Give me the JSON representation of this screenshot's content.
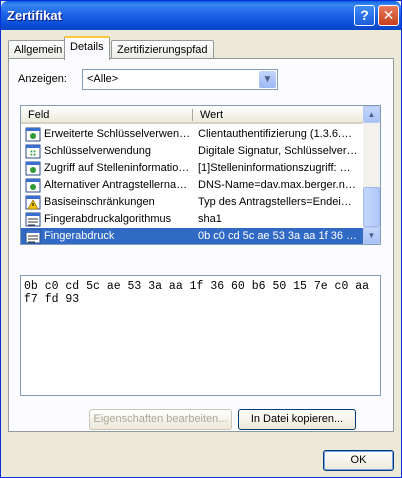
{
  "window": {
    "title": "Zertifikat",
    "help_label": "?",
    "close_label": "✕"
  },
  "tabs": [
    {
      "label": "Allgemein"
    },
    {
      "label": "Details"
    },
    {
      "label": "Zertifizierungspfad"
    }
  ],
  "show": {
    "label": "Anzeigen:",
    "value": "<Alle>"
  },
  "list": {
    "col_field": "Feld",
    "col_value": "Wert",
    "rows": [
      {
        "field": "Erweiterte Schlüsselverwen…",
        "value": "Clientauthentifizierung (1.3.6.…",
        "icon": "extension-icon"
      },
      {
        "field": "Schlüsselverwendung",
        "value": "Digitale Signatur, Schlüsselver…",
        "icon": "critical-extension-icon"
      },
      {
        "field": "Zugriff auf Stelleninformatio…",
        "value": "[1]Stelleninformationszugriff: …",
        "icon": "extension-icon"
      },
      {
        "field": "Alternativer Antragstellerna…",
        "value": "DNS-Name=dav.max.berger.n…",
        "icon": "extension-icon"
      },
      {
        "field": "Basiseinschränkungen",
        "value": "Typ des Antragstellers=Endei…",
        "icon": "warning-extension-icon"
      },
      {
        "field": "Fingerabdruckalgorithmus",
        "value": "sha1",
        "icon": "property-icon"
      },
      {
        "field": "Fingerabdruck",
        "value": "0b c0 cd 5c ae 53 3a aa 1f 36 …",
        "icon": "property-icon",
        "selected": true
      }
    ]
  },
  "detail_text": "0b c0 cd 5c ae 53 3a aa 1f 36 60 b6 50 15 7e c0 aa f7 fd 93",
  "buttons": {
    "edit": "Eigenschaften bearbeiten...",
    "copy": "In Datei kopieren...",
    "ok": "OK"
  }
}
